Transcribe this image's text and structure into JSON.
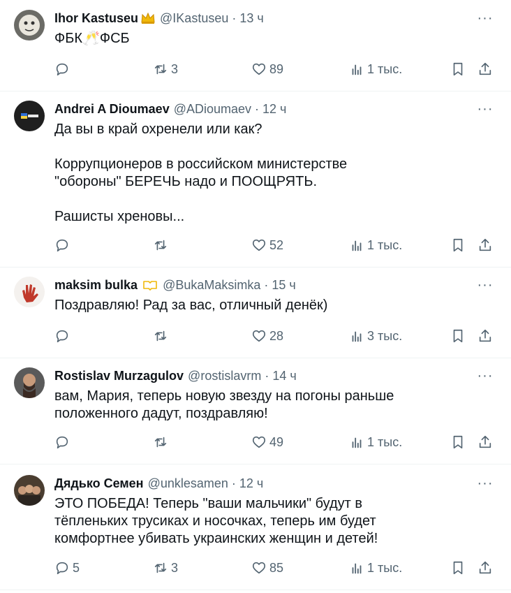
{
  "posts": [
    {
      "name": "Ihor Kastuseu",
      "badge": "crown",
      "handle": "@IKastuseu",
      "time": "· 13 ч",
      "lines": [
        "ФБК🥂ФСБ"
      ],
      "replies": "",
      "reposts": "3",
      "likes": "89",
      "views": "1 тыс."
    },
    {
      "name": "Andrei A Dioumaev",
      "badge": "",
      "handle": "@ADioumaev",
      "time": "· 12 ч",
      "lines": [
        "Да вы в край охренели или как?",
        "",
        "Коррупционеров в российском министерстве",
        "\"обороны\" БЕРЕЧЬ надо и ПООЩРЯТЬ.",
        "",
        "Рашисты хреновы..."
      ],
      "replies": "",
      "reposts": "",
      "likes": "52",
      "views": "1 тыс."
    },
    {
      "name": "maksim bulka",
      "badge": "gold-verified",
      "handle": "@BukaMaksimka",
      "time": "· 15 ч",
      "lines": [
        "Поздравляю! Рад за вас, отличный денёк)"
      ],
      "replies": "",
      "reposts": "",
      "likes": "28",
      "views": "3 тыс."
    },
    {
      "name": "Rostislav Murzagulov",
      "badge": "",
      "handle": "@rostislavrm",
      "time": "· 14 ч",
      "lines": [
        "вам, Мария, теперь новую звезду на погоны раньше",
        "положенного дадут, поздравляю!"
      ],
      "replies": "",
      "reposts": "",
      "likes": "49",
      "views": "1 тыс."
    },
    {
      "name": "Дядько Семен",
      "badge": "",
      "handle": "@unklesamen",
      "time": "· 12 ч",
      "lines": [
        "ЭТО ПОБЕДА! Теперь \"ваши мальчики\" будут в",
        "тёпленьких трусиках и носочках, теперь им будет",
        "комфортнее убивать украинских женщин и детей!"
      ],
      "replies": "5",
      "reposts": "3",
      "likes": "85",
      "views": "1 тыс."
    }
  ],
  "more_label": "···",
  "colors": {
    "text": "#0f1419",
    "secondary": "#536471",
    "divider": "#eff3f4",
    "gold": "#f0b90b"
  },
  "icons": {
    "reply": "reply-icon",
    "repost": "repost-icon",
    "like": "like-icon",
    "views": "views-icon",
    "bookmark": "bookmark-icon",
    "share": "share-icon",
    "more": "more-icon"
  }
}
